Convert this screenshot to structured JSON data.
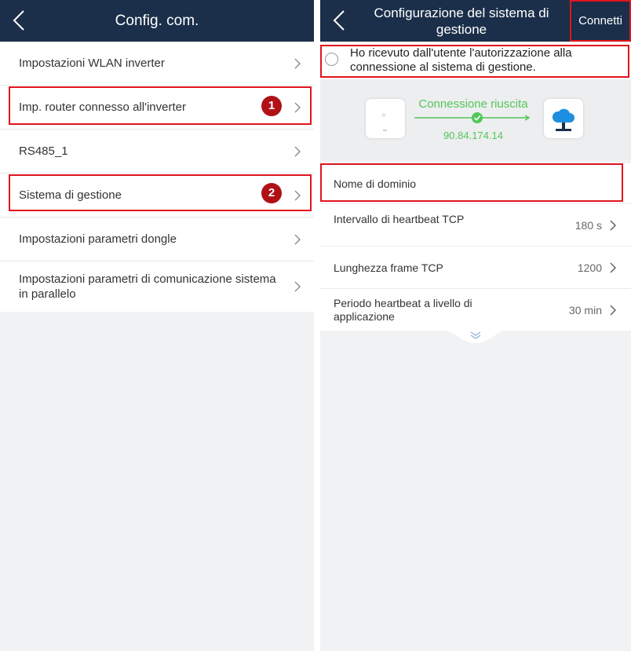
{
  "left_screen": {
    "title": "Config. com.",
    "items": [
      {
        "label": "Impostazioni WLAN inverter"
      },
      {
        "label": "Imp. router connesso all'inverter",
        "badge": "1"
      },
      {
        "label": "RS485_1"
      },
      {
        "label": "Sistema di gestione",
        "badge": "2"
      },
      {
        "label": "Impostazioni parametri dongle"
      },
      {
        "label": "Impostazioni parametri di comunicazione sistema in parallelo"
      }
    ]
  },
  "right_screen": {
    "title": "Configurazione del sistema di gestione",
    "connect_button": "Connetti",
    "consent_text": "Ho ricevuto dall'utente l'autorizzazione alla connessione al sistema di gestione.",
    "consent_checked": false,
    "connection_status": "Connessione riuscita",
    "ip_address": "90.84.174.14",
    "fields": [
      {
        "label": "Nome di dominio",
        "value": ""
      },
      {
        "label": "Intervallo di heartbeat TCP",
        "value": "180 s"
      },
      {
        "label": "Lunghezza frame TCP",
        "value": "1200"
      },
      {
        "label": "Periodo heartbeat a livello di applicazione",
        "value": "30 min"
      }
    ]
  },
  "colors": {
    "header_bg": "#1b2f4a",
    "highlight_red": "#e0141e",
    "badge_red": "#b01116",
    "success_green": "#52c65a",
    "cloud_blue": "#1d8fe0"
  },
  "icons": [
    "back-arrow-icon",
    "chevron-right-icon",
    "check-icon",
    "cloud-icon",
    "monitor-icon",
    "expand-more-icon"
  ]
}
